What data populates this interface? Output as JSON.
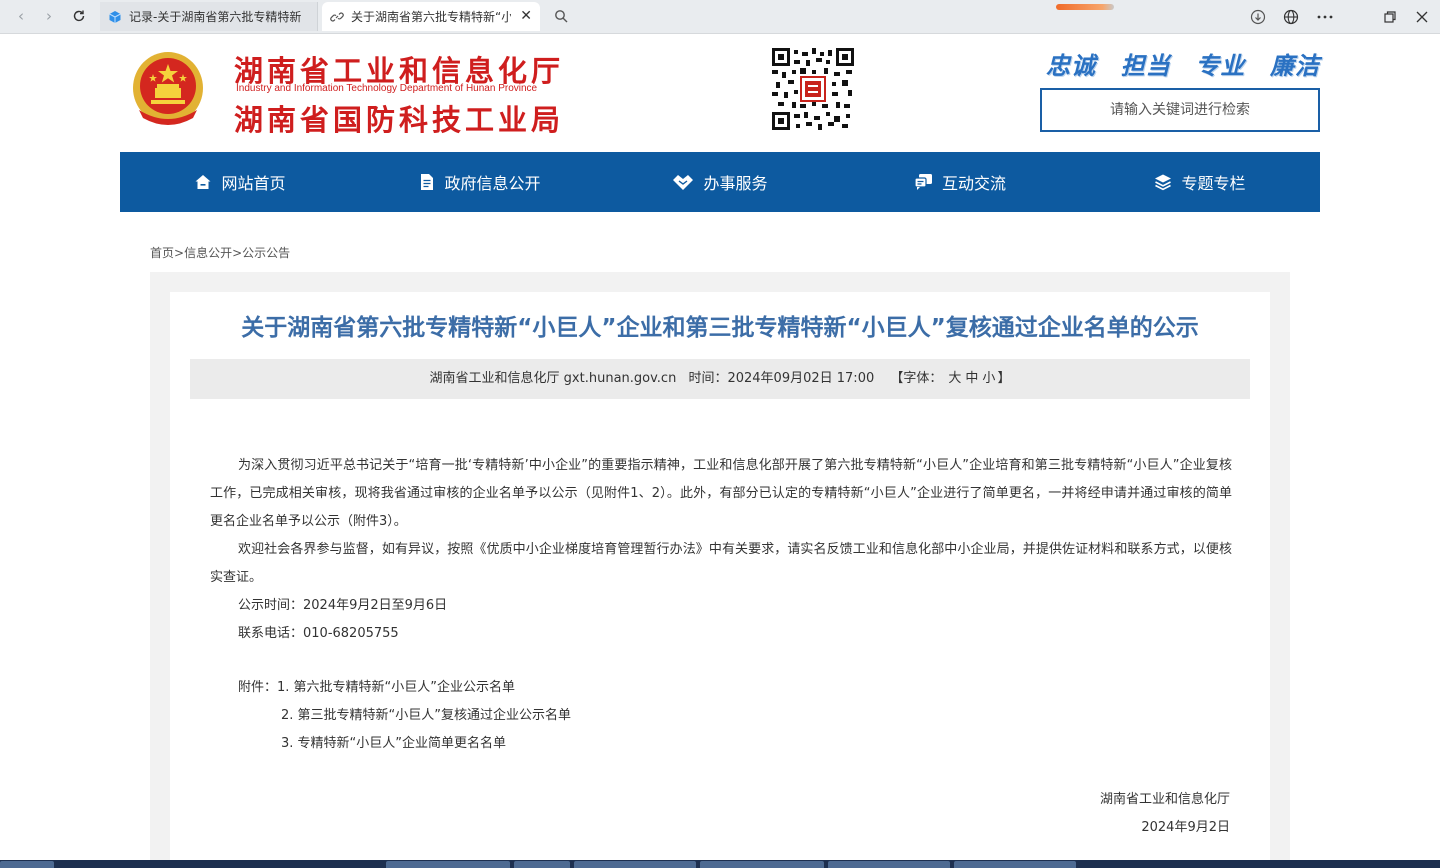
{
  "browser": {
    "tabs": [
      {
        "title": "记录-关于湖南省第六批专精特新",
        "active": false
      },
      {
        "title": "关于湖南省第六批专精特新“小",
        "active": true
      }
    ],
    "close_glyph": "✕"
  },
  "header": {
    "title_line1": "湖南省工业和信息化厅",
    "subtitle_en": "Industry and Information Technology Department of Hunan Province",
    "title_line2": "湖南省国防科技工业局",
    "slogans": [
      "忠诚",
      "担当",
      "专业",
      "廉洁"
    ],
    "search_placeholder": "请输入关键词进行检索"
  },
  "nav": {
    "items": [
      {
        "label": "网站首页",
        "icon": "home-icon"
      },
      {
        "label": "政府信息公开",
        "icon": "document-icon"
      },
      {
        "label": "办事服务",
        "icon": "handshake-icon"
      },
      {
        "label": "互动交流",
        "icon": "chat-icon"
      },
      {
        "label": "专题专栏",
        "icon": "layers-icon"
      }
    ]
  },
  "breadcrumb": {
    "home": "首页",
    "sep": ">",
    "level1": "信息公开",
    "level2": "公示公告"
  },
  "article": {
    "title": "关于湖南省第六批专精特新“小巨人”企业和第三批专精特新“小巨人”复核通过企业名单的公示",
    "source": "湖南省工业和信息化厅 gxt.hunan.gov.cn",
    "time": "时间：2024年09月02日 17:00",
    "font_label_open": "【字体：",
    "font_large": "大",
    "font_medium": "中",
    "font_small": "小",
    "font_label_close": "】",
    "paragraph1": "为深入贯彻习近平总书记关于“培育一批‘专精特新’中小企业”的重要指示精神，工业和信息化部开展了第六批专精特新“小巨人”企业培育和第三批专精特新“小巨人”企业复核工作，已完成相关审核，现将我省通过审核的企业名单予以公示（见附件1、2）。此外，有部分已认定的专精特新“小巨人”企业进行了简单更名，一并将经申请并通过审核的简单更名企业名单予以公示（附件3）。",
    "paragraph2": "欢迎社会各界参与监督，如有异议，按照《优质中小企业梯度培育管理暂行办法》中有关要求，请实名反馈工业和信息化部中小企业局，并提供佐证材料和联系方式，以便核实查证。",
    "period": "公示时间：2024年9月2日至9月6日",
    "phone": "联系电话：010-68205755",
    "attachments_label": "附件：",
    "attachments": [
      "1. 第六批专精特新“小巨人”企业公示名单",
      "2. 第三批专精特新“小巨人”复核通过企业公示名单",
      "3. 专精特新“小巨人”企业简单更名名单"
    ],
    "signature_org": "湖南省工业和信息化厅",
    "signature_date": "2024年9月2日"
  },
  "colors": {
    "brand_red": "#cf1e1e",
    "nav_blue": "#0d5aa0",
    "title_blue": "#3c6da7",
    "slogan_blue": "#2a71c2"
  }
}
